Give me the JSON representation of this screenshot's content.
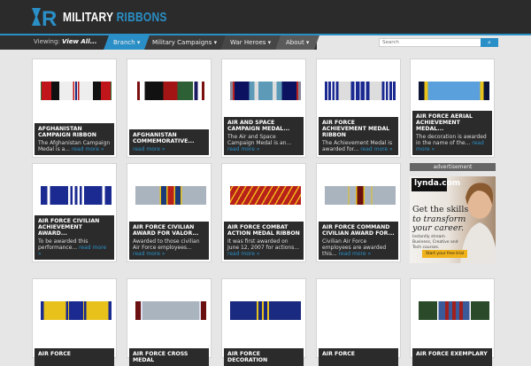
{
  "header": {
    "logo_a": "MILITARY",
    "logo_b": "RIBBONS"
  },
  "nav": {
    "viewing_label": "Viewing:",
    "viewing_value": "View All...",
    "items": [
      "Branch ▾",
      "Military Campaigns ▾",
      "War Heroes ▾",
      "About ▾"
    ],
    "search_placeholder": "Search",
    "search_icon": "⌕"
  },
  "accent": "#2a8fc6",
  "read_more": "read more »",
  "cards": [
    {
      "title": "Afghanistan Campaign Ribbon",
      "desc": "The Afghanistan Campaign Medal is a...",
      "stripes": [
        [
          "#2d6e35",
          1
        ],
        [
          "#c0151a",
          10
        ],
        [
          "#111",
          8
        ],
        [
          "#eee",
          14
        ],
        [
          "#c0151a",
          1
        ],
        [
          "#eee",
          1
        ],
        [
          "#1a2a80",
          2
        ],
        [
          "#eee",
          1
        ],
        [
          "#c0151a",
          1
        ],
        [
          "#eee",
          14
        ],
        [
          "#111",
          8
        ],
        [
          "#c0151a",
          10
        ],
        [
          "#2d6e35",
          1
        ]
      ]
    },
    {
      "title": "Afghanistan Commemorative...",
      "desc": "",
      "stripes": [
        [
          "#fff",
          2
        ],
        [
          "#7a1010",
          3
        ],
        [
          "#fff",
          6
        ],
        [
          "#111",
          22
        ],
        [
          "#a31515",
          17
        ],
        [
          "#2d6035",
          18
        ],
        [
          "#fff",
          2
        ],
        [
          "#1a1a60",
          4
        ],
        [
          "#fff",
          5
        ],
        [
          "#7a1010",
          3
        ],
        [
          "#fff",
          2
        ]
      ]
    },
    {
      "title": "Air and Space Campaign Medal...",
      "desc": "The Air and Space Campaign Medal is an...",
      "stripes": [
        [
          "#889",
          3
        ],
        [
          "#b22",
          2
        ],
        [
          "#0c1260",
          16
        ],
        [
          "#5c9ab8",
          6
        ],
        [
          "#ddd",
          4
        ],
        [
          "#5c9ab8",
          16
        ],
        [
          "#ddd",
          4
        ],
        [
          "#5c9ab8",
          6
        ],
        [
          "#0c1260",
          16
        ],
        [
          "#b22",
          2
        ],
        [
          "#889",
          3
        ]
      ]
    },
    {
      "title": "Air Force Achievement Medal Ribbon",
      "desc": "The Achievement Medal is awarded for...",
      "stripes": [
        [
          "#1a2a90",
          2
        ],
        [
          "#fff",
          1
        ],
        [
          "#1a2a90",
          2
        ],
        [
          "#fff",
          1
        ],
        [
          "#1a2a90",
          2
        ],
        [
          "#fff",
          1
        ],
        [
          "#1a2a90",
          2
        ],
        [
          "#ddd",
          10
        ],
        [
          "#1a2a90",
          3
        ],
        [
          "#fff",
          1
        ],
        [
          "#1a2a90",
          3
        ],
        [
          "#fff",
          1
        ],
        [
          "#1a2a90",
          3
        ],
        [
          "#fff",
          1
        ],
        [
          "#1a2a90",
          3
        ],
        [
          "#ddd",
          10
        ],
        [
          "#1a2a90",
          2
        ],
        [
          "#fff",
          1
        ],
        [
          "#1a2a90",
          2
        ],
        [
          "#fff",
          1
        ],
        [
          "#1a2a90",
          2
        ],
        [
          "#fff",
          1
        ],
        [
          "#1a2a90",
          2
        ]
      ]
    },
    {
      "title": "Air Force Aerial Achievement Medal...",
      "desc": "The decoration is awarded in the name of the...",
      "stripes": [
        [
          "#0c1538",
          6
        ],
        [
          "#e8c21a",
          4
        ],
        [
          "#5aa0dc",
          56
        ],
        [
          "#e8c21a",
          4
        ],
        [
          "#0c1538",
          6
        ]
      ]
    },
    {
      "title": "Air Force Civilian Achievement Award...",
      "desc": "To be awarded this performance...",
      "stripes": [
        [
          "#1a2a90",
          6
        ],
        [
          "#fff",
          2
        ],
        [
          "#1a2a90",
          16
        ],
        [
          "#fff",
          2
        ],
        [
          "#1a2a90",
          2
        ],
        [
          "#fff",
          2
        ],
        [
          "#1a2a90",
          2
        ],
        [
          "#fff",
          2
        ],
        [
          "#1a2a90",
          2
        ],
        [
          "#fff",
          2
        ],
        [
          "#1a2a90",
          16
        ],
        [
          "#fff",
          2
        ],
        [
          "#1a2a90",
          6
        ]
      ]
    },
    {
      "title": "Air Force Civilian Award for Valor...",
      "desc": "Awarded to those civilian Air Force employees...",
      "stripes": [
        [
          "#a9b4be",
          26
        ],
        [
          "#e8c21a",
          1
        ],
        [
          "#1a3a7a",
          6
        ],
        [
          "#e8c21a",
          1
        ],
        [
          "#b8201a",
          7
        ],
        [
          "#e8c21a",
          1
        ],
        [
          "#1a3a7a",
          6
        ],
        [
          "#e8c21a",
          1
        ],
        [
          "#a9b4be",
          26
        ]
      ]
    },
    {
      "title": "Air Force Combat Action Medal Ribbon",
      "desc": "It was first awarded on June 12, 2007 for actions...",
      "diagonal": [
        "#b8201a",
        "#f0b21b"
      ],
      "stripes": []
    },
    {
      "title": "Air Force Command Civilian Award for...",
      "desc": "Civilian Air Force employees are awarded this...",
      "stripes": [
        [
          "#a9b4be",
          25
        ],
        [
          "#e8c21a",
          1
        ],
        [
          "#a9b4be",
          7
        ],
        [
          "#e8c21a",
          1
        ],
        [
          "#6a1010",
          7
        ],
        [
          "#e8c21a",
          1
        ],
        [
          "#a9b4be",
          7
        ],
        [
          "#e8c21a",
          1
        ],
        [
          "#a9b4be",
          25
        ]
      ]
    },
    {
      "title": "Air Force",
      "desc": "",
      "stripes": [
        [
          "#1a2a90",
          3
        ],
        [
          "#e8c21a",
          22
        ],
        [
          "#1a2a90",
          2
        ],
        [
          "#e8c21a",
          1
        ],
        [
          "#1a2a90",
          14
        ],
        [
          "#e8c21a",
          1
        ],
        [
          "#1a2a90",
          2
        ],
        [
          "#e8c21a",
          22
        ],
        [
          "#1a2a90",
          3
        ]
      ]
    },
    {
      "title": "Air Force Cross Medal",
      "desc": "",
      "stripes": [
        [
          "#6a1010",
          6
        ],
        [
          "#dde",
          2
        ],
        [
          "#a9b4be",
          64
        ],
        [
          "#dde",
          2
        ],
        [
          "#6a1010",
          6
        ]
      ]
    },
    {
      "title": "Air Force Decoration",
      "desc": "",
      "stripes": [
        [
          "#1a2a80",
          30
        ],
        [
          "#e8c21a",
          2
        ],
        [
          "#1a2a80",
          4
        ],
        [
          "#e8c21a",
          2
        ],
        [
          "#1a2a80",
          4
        ],
        [
          "#e8c21a",
          2
        ],
        [
          "#1a2a80",
          36
        ]
      ]
    },
    {
      "title": "Air Force",
      "desc": "",
      "stripes": [
        [
          "#f0d020",
          6
        ],
        [
          "#2a3a b0",
          0
        ],
        [
          "#2a3ab0",
          14
        ],
        [
          "#e8c21a",
          3
        ],
        [
          "#ddd",
          34
        ],
        [
          "#e8c21a",
          3
        ],
        [
          "#2a3ab0",
          14
        ],
        [
          "#f0d020",
          6
        ]
      ]
    },
    {
      "title": "Air Force Exemplary",
      "desc": "",
      "stripes": [
        [
          "#2a4a2a",
          16
        ],
        [
          "#fff",
          1
        ],
        [
          "#3a5a9a",
          6
        ],
        [
          "#a02020",
          3
        ],
        [
          "#3a5a9a",
          3
        ],
        [
          "#a02020",
          3
        ],
        [
          "#3a5a9a",
          3
        ],
        [
          "#a02020",
          3
        ],
        [
          "#3a5a9a",
          6
        ],
        [
          "#fff",
          1
        ],
        [
          "#2a4a2a",
          16
        ]
      ]
    }
  ],
  "ad": {
    "label": "advertisement",
    "brand": "lynda.com",
    "headline_1": "Get the skills",
    "headline_2": "to transform",
    "headline_3": "your career.",
    "sub": "Instantly stream Business, Creative and Tech courses.",
    "cta": "Start your free trial"
  }
}
